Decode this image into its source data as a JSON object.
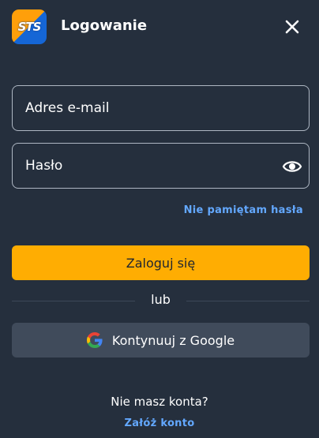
{
  "header": {
    "logo_text": "STS",
    "title": "Logowanie"
  },
  "form": {
    "email_placeholder": "Adres e-mail",
    "email_value": "",
    "password_placeholder": "Hasło",
    "password_value": "",
    "forgot_label": "Nie pamiętam hasła",
    "login_label": "Zaloguj się",
    "divider_label": "lub",
    "google_label": "Kontynuuj z Google"
  },
  "footer": {
    "no_account_text": "Nie masz konta?",
    "register_label": "Załóż konto"
  },
  "icons": {
    "close": "close-icon",
    "eye": "eye-icon",
    "google": "google-icon"
  },
  "colors": {
    "background": "#252f3d",
    "primary": "#ffad02",
    "link": "#63a8ff",
    "secondary_button": "#404b5b",
    "logo_orange": "#ff9f0a",
    "logo_blue": "#1566d6"
  }
}
